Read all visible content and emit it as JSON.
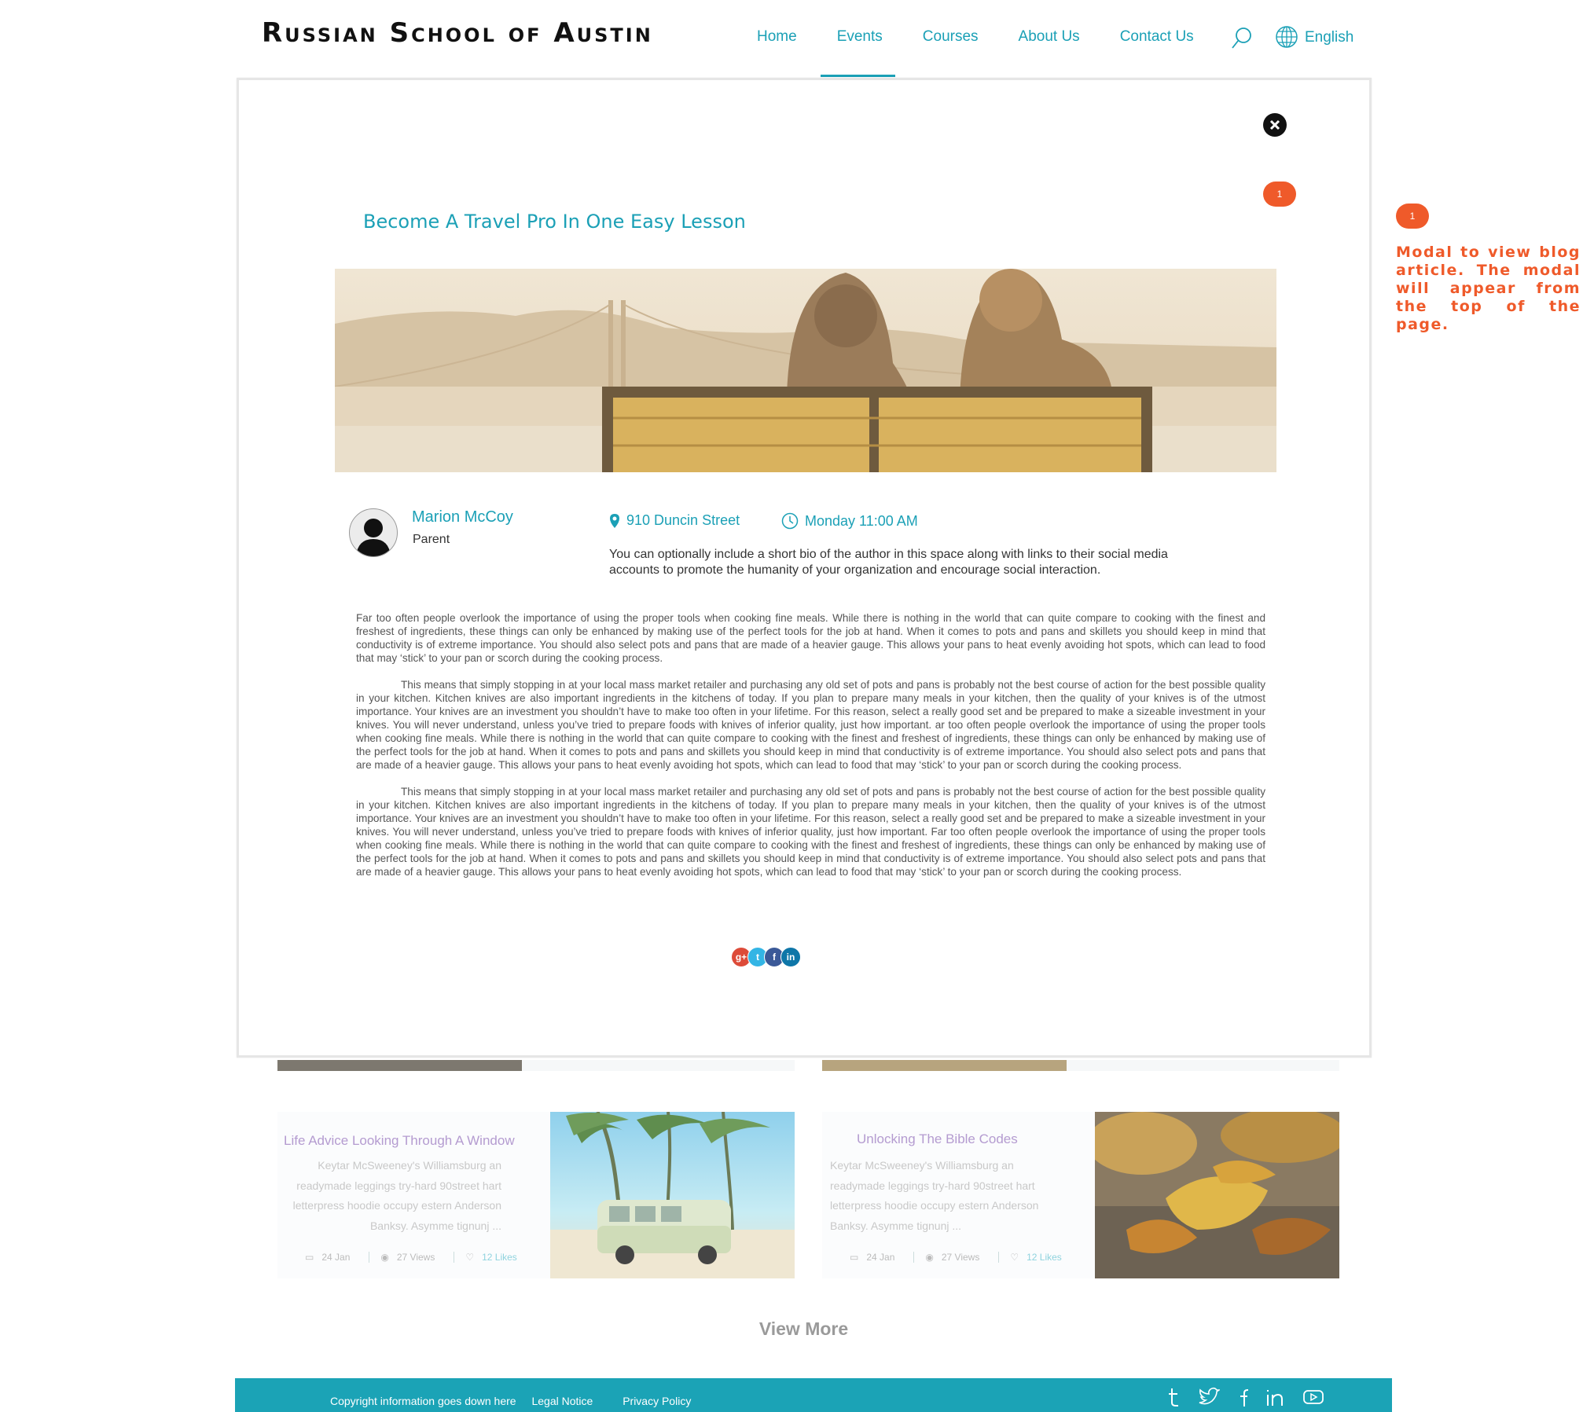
{
  "header": {
    "logo": "Russian School of Austin",
    "nav": [
      {
        "label": "Home"
      },
      {
        "label": "Events",
        "active": true
      },
      {
        "label": "Courses"
      },
      {
        "label": "About Us"
      },
      {
        "label": "Contact Us"
      }
    ],
    "search_icon": "search-icon",
    "language": "English",
    "language_icon": "globe-icon"
  },
  "modal": {
    "badge": "1",
    "title": "Become A Travel Pro In One Easy Lesson",
    "hero_image": "couple-on-bench-golden-gate",
    "author": {
      "name": "Marion McCoy",
      "role": "Parent"
    },
    "location": "910 Duncin Street",
    "time": "Monday 11:00 AM",
    "bio": "You can optionally include a short bio of the author in this space along with links to their social media accounts to promote the humanity of your organization and encourage social interaction.",
    "paragraphs": [
      "Far too often people overlook the importance of using the proper tools when cooking fine meals. While there is nothing in the world that can quite compare to cooking with the finest and freshest of ingredients, these things can only be enhanced by making use of the perfect tools for the job at hand. When it comes to pots and pans and skillets you should keep in mind that conductivity is of extreme importance. You should also select pots and pans that are made of a heavier gauge. This allows your pans to heat evenly avoiding hot spots, which can lead to food that may ‘stick’ to your pan or scorch during the cooking process.",
      "This means that simply stopping in at your local mass market retailer and purchasing any old set of pots and pans is probably not the best course of action for the best possible quality in your kitchen. Kitchen knives are also important ingredients in the kitchens of today. If you plan to prepare many meals in your kitchen, then the quality of your knives is of the utmost importance. Your knives are an investment you shouldn’t have to make too often in your lifetime. For this reason, select a really good set and be prepared to make a sizeable investment in your knives. You will never understand, unless you’ve tried to prepare foods with knives of inferior quality, just how important.  ar too often people overlook the importance of using the proper tools when cooking fine meals. While there is nothing in the world that can quite compare to cooking with the finest and freshest of ingredients, these things can only be enhanced by making use of the perfect tools for the job at hand. When it comes to pots and pans and skillets you should keep in mind that conductivity is of extreme importance. You should also select pots and pans that are made of a heavier gauge. This allows your pans to heat evenly avoiding hot spots, which can lead to food that may ‘stick’ to your pan or scorch during the cooking process.",
      "This means that simply stopping in at your local mass market retailer and purchasing any old set of pots and pans is probably not the best course of action for the best possible quality in your kitchen. Kitchen knives are also important ingredients in the kitchens of today. If you plan to prepare many meals in your kitchen, then the quality of your knives is of the utmost importance. Your knives are an investment you shouldn’t have to make too often in your lifetime. For this reason, select a really good set and be prepared to make a sizeable investment in your knives. You will never understand, unless you’ve tried to prepare foods with knives of inferior quality, just how important.  Far too often people overlook the importance of using the proper tools when cooking fine meals. While there is nothing in the world that can quite compare to cooking with the finest and freshest of ingredients, these things can only be enhanced by making use of the perfect tools for the job at hand. When it comes to pots and pans and skillets you should keep in mind that conductivity is of extreme importance. You should also select pots and pans that are made of a heavier gauge. This allows your pans to heat evenly avoiding hot spots, which can lead to food that may ‘stick’ to your pan or scorch during the cooking process."
    ],
    "share": [
      {
        "icon": "google-plus-icon",
        "glyph": "g+",
        "color": "#dd4b39"
      },
      {
        "icon": "twitter-icon",
        "glyph": "t",
        "color": "#33b5e5"
      },
      {
        "icon": "facebook-icon",
        "glyph": "f",
        "color": "#3b5998"
      },
      {
        "icon": "linkedin-icon",
        "glyph": "in",
        "color": "#0e76a8"
      }
    ]
  },
  "annotation": {
    "badge": "1",
    "text": "Modal to view blog article. The modal will appear from the top of the page."
  },
  "background_cards": [
    {
      "title": "Life Advice Looking Through A Window",
      "excerpt": "Keytar McSweeney's Williamsburg an readymade leggings try-hard 90street hart letterpress hoodie occupy estern Anderson Banksy. Asymme tignunj ...",
      "date": "24 Jan",
      "views": "27 Views",
      "likes": "12 Likes",
      "image": "beach-van-palm-trees"
    },
    {
      "title": "Unlocking The Bible Codes",
      "excerpt": "Keytar McSweeney's Williamsburg an readymade leggings try-hard 90street hart letterpress hoodie occupy estern Anderson Banksy. Asymme tignunj ...",
      "date": "24 Jan",
      "views": "27 Views",
      "likes": "12 Likes",
      "image": "autumn-leaves"
    }
  ],
  "view_more": "View More",
  "footer": {
    "copyright": "Copyright information goes down here",
    "legal": "Legal Notice",
    "privacy": "Privacy Policy",
    "social": [
      "tumblr-icon",
      "twitter-icon",
      "facebook-icon",
      "linkedin-icon",
      "youtube-icon"
    ]
  },
  "colors": {
    "accent": "#1ba0b6",
    "annotation": "#ef5a2a",
    "footer": "#1ba3b6"
  }
}
